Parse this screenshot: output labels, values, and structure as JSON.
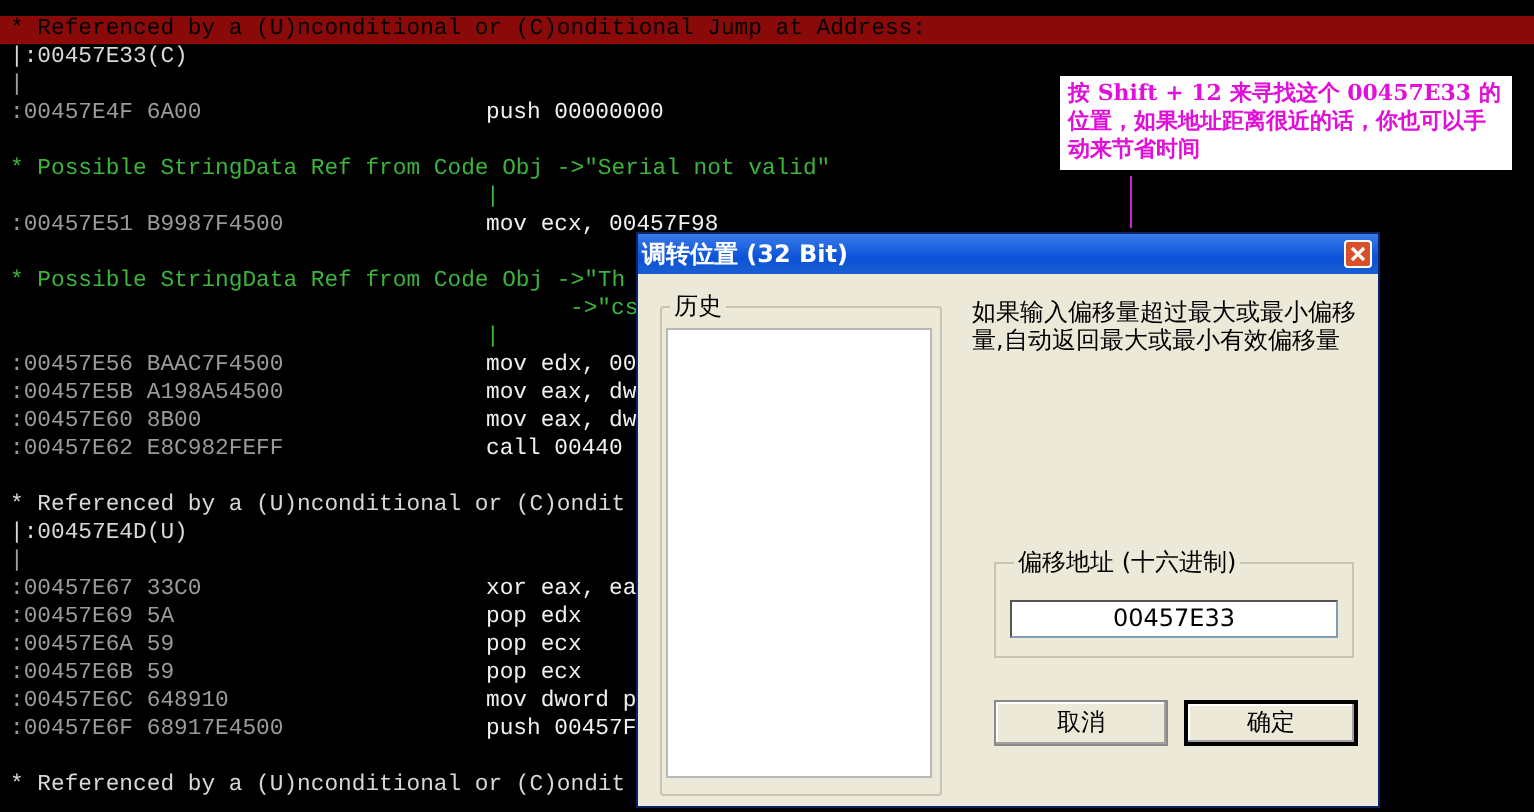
{
  "listing": [
    {
      "kind": "ref_header",
      "text": "* Referenced by a (U)nconditional or (C)onditional Jump at Address:"
    },
    {
      "kind": "ref_address",
      "text": "|:00457E33(C)"
    },
    {
      "kind": "pipe",
      "text": "|"
    },
    {
      "kind": "code",
      "address": ":00457E4F 6A00",
      "instruction": "push 00000000"
    },
    {
      "kind": "blank"
    },
    {
      "kind": "comment",
      "text": "* Possible StringData Ref from Code Obj ->\"Serial not valid\""
    },
    {
      "kind": "pipe_right",
      "text": "|"
    },
    {
      "kind": "code",
      "address": ":00457E51 B9987F4500",
      "instruction": "mov ecx, 00457F98"
    },
    {
      "kind": "blank"
    },
    {
      "kind": "comment",
      "text": "* Possible StringData Ref from Code Obj ->\"Th"
    },
    {
      "kind": "comment_right",
      "text": "->\"cs"
    },
    {
      "kind": "pipe_right",
      "text": "|"
    },
    {
      "kind": "code",
      "address": ":00457E56 BAAC7F4500",
      "instruction": "mov edx, 00"
    },
    {
      "kind": "code",
      "address": ":00457E5B A198A54500",
      "instruction": "mov eax, dw"
    },
    {
      "kind": "code",
      "address": ":00457E60 8B00",
      "instruction": "mov eax, dw"
    },
    {
      "kind": "code",
      "address": ":00457E62 E8C982FEFF",
      "instruction": "call 00440"
    },
    {
      "kind": "blank"
    },
    {
      "kind": "ref",
      "text": "* Referenced by a (U)nconditional or (C)ondit"
    },
    {
      "kind": "ref_address",
      "text": "|:00457E4D(U)"
    },
    {
      "kind": "pipe",
      "text": "|"
    },
    {
      "kind": "code",
      "address": ":00457E67 33C0",
      "instruction": "xor eax, ea"
    },
    {
      "kind": "code",
      "address": ":00457E69 5A",
      "instruction": "pop edx"
    },
    {
      "kind": "code",
      "address": ":00457E6A 59",
      "instruction": "pop ecx"
    },
    {
      "kind": "code",
      "address": ":00457E6B 59",
      "instruction": "pop ecx"
    },
    {
      "kind": "code",
      "address": ":00457E6C 648910",
      "instruction": "mov dword p"
    },
    {
      "kind": "code",
      "address": ":00457E6F 68917E4500",
      "instruction": "push 00457F"
    },
    {
      "kind": "blank"
    },
    {
      "kind": "ref",
      "text": "* Referenced by a (U)nconditional or (C)ondit"
    }
  ],
  "annotation": {
    "text": "按 Shift + 12 来寻找这个 00457E33 的位置，如果地址距离很近的话，你也可以手动来节省时间"
  },
  "dialog": {
    "title": "调转位置 (32 Bit)",
    "history": {
      "label": "历史"
    },
    "description": "如果输入偏移量超过最大或最小偏移量,自动返回最大或最小有效偏移量",
    "offset_group": {
      "label": "偏移地址 (十六进制)",
      "value": "00457E33"
    },
    "buttons": [
      {
        "label": "取消",
        "default": false
      },
      {
        "label": "确定",
        "default": true
      }
    ]
  }
}
